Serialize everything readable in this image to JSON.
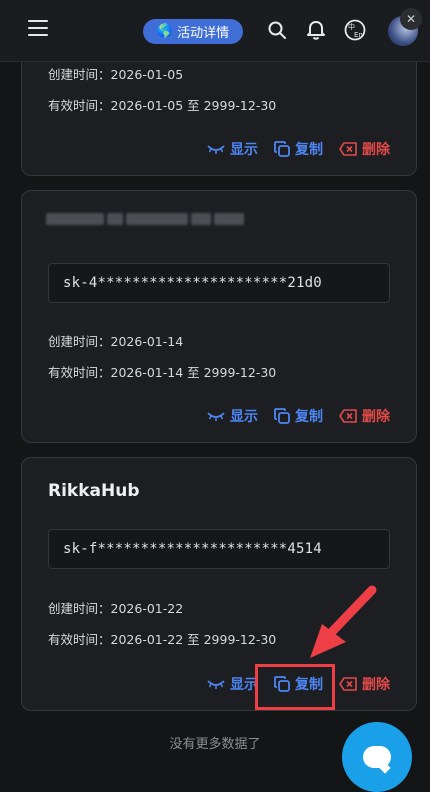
{
  "header": {
    "event_button_label": "活动详情",
    "icons": [
      "menu-icon",
      "search-icon",
      "bell-icon",
      "language-icon",
      "avatar"
    ]
  },
  "cards": [
    {
      "title": "",
      "key": "",
      "created_label": "创建时间：",
      "created_value": "2026-01-05",
      "valid_label": "有效时间：",
      "valid_value": "2026-01-05 至 2999-12-30",
      "actions": {
        "show": "显示",
        "copy": "复制",
        "delete": "删除"
      }
    },
    {
      "title": "",
      "key": "sk-4**********************21d0",
      "created_label": "创建时间：",
      "created_value": "2026-01-14",
      "valid_label": "有效时间：",
      "valid_value": "2026-01-14 至 2999-12-30",
      "actions": {
        "show": "显示",
        "copy": "复制",
        "delete": "删除"
      }
    },
    {
      "title": "RikkaHub",
      "key": "sk-f**********************4514",
      "created_label": "创建时间：",
      "created_value": "2026-01-22",
      "valid_label": "有效时间：",
      "valid_value": "2026-01-22 至 2999-12-30",
      "actions": {
        "show": "显示",
        "copy": "复制",
        "delete": "删除"
      }
    }
  ],
  "footer": {
    "no_more": "没有更多数据了"
  },
  "colors": {
    "accent": "#4d86f2",
    "danger": "#e24a4a",
    "highlight": "#ee3e46",
    "fab": "#1aa0e8"
  }
}
